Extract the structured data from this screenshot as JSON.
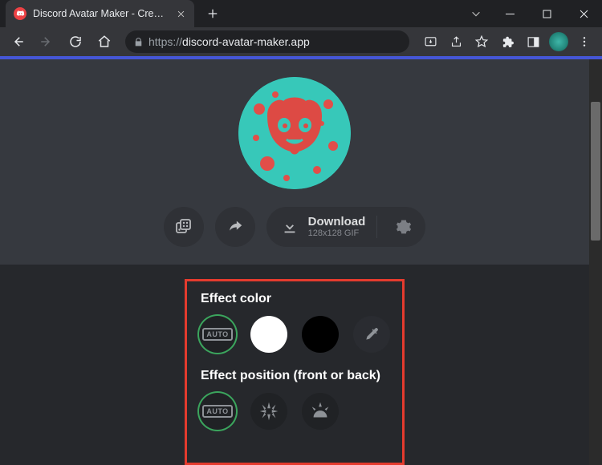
{
  "browser": {
    "tab_title": "Discord Avatar Maker - Create y",
    "url_scheme": "https://",
    "url_host_path": "discord-avatar-maker.app"
  },
  "toolbar": {
    "download_label": "Download",
    "download_sub": "128x128 GIF"
  },
  "panels": {
    "effect_color_title": "Effect color",
    "effect_position_title": "Effect position (front or back)",
    "auto_label": "AUTO"
  }
}
